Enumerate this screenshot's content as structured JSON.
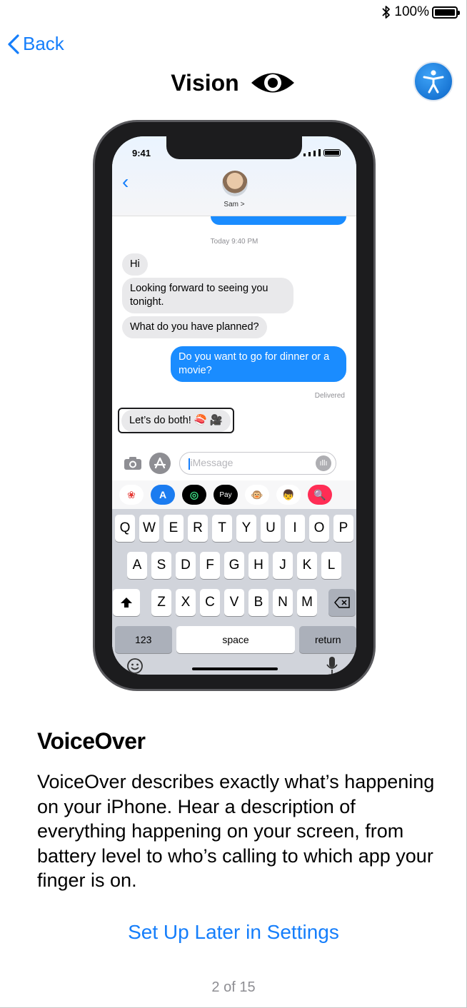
{
  "status": {
    "battery_text": "100%"
  },
  "nav": {
    "back_label": "Back",
    "title": "Vision"
  },
  "phone": {
    "time": "9:41",
    "contact_name": "Sam >",
    "timestamp": "Today 9:40 PM",
    "incoming": [
      "Hi",
      "Looking forward to seeing you tonight.",
      "What do you have planned?"
    ],
    "outgoing": "Do you want to go for dinner or a movie?",
    "delivered": "Delivered",
    "focused_message": "Let’s do both! 🍣 🎥",
    "composer_placeholder": "iMessage",
    "apps": [
      "❀",
      "A",
      "◎",
      "Pay",
      "🐵",
      "👦",
      "🔍"
    ],
    "keyboard": {
      "row1": [
        "Q",
        "W",
        "E",
        "R",
        "T",
        "Y",
        "U",
        "I",
        "O",
        "P"
      ],
      "row2": [
        "A",
        "S",
        "D",
        "F",
        "G",
        "H",
        "J",
        "K",
        "L"
      ],
      "row3": [
        "Z",
        "X",
        "C",
        "V",
        "B",
        "N",
        "M"
      ],
      "numbers": "123",
      "space": "space",
      "return": "return"
    }
  },
  "content": {
    "heading": "VoiceOver",
    "description": "VoiceOver describes exactly what’s happening on your iPhone. Hear a description of everything happening on your screen, from battery level to who’s calling to which app your finger is on.",
    "link": "Set Up Later in Settings",
    "pager": "2 of 15"
  },
  "colors": {
    "accent": "#157efb",
    "bubble_out": "#1a8cff",
    "bubble_in": "#e9e9eb"
  },
  "icons": [
    "bluetooth-icon",
    "battery-icon",
    "chevron-left-icon",
    "eye-icon",
    "accessibility-icon",
    "camera-icon",
    "app-store-icon",
    "audio-icon",
    "shift-icon",
    "delete-icon",
    "emoji-icon",
    "microphone-icon"
  ]
}
